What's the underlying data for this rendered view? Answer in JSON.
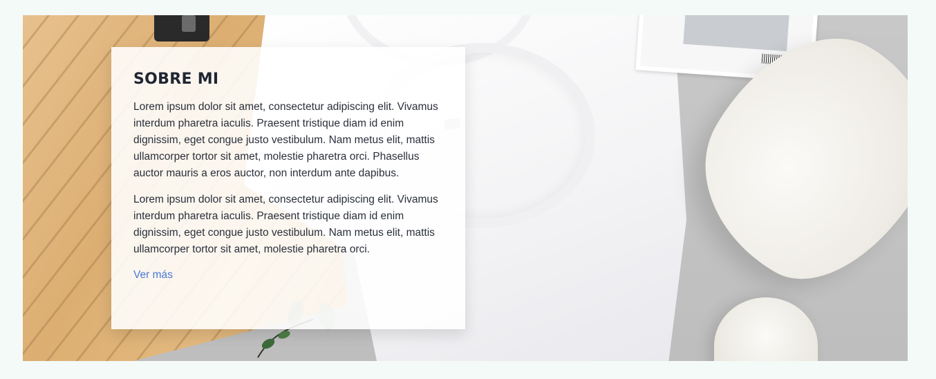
{
  "about": {
    "title": "SOBRE MI",
    "paragraph_1": "Lorem ipsum dolor sit amet, consectetur adipiscing elit. Vivamus interdum pharetra iaculis. Praesent tristique diam id enim dignissim, eget congue justo vestibulum. Nam metus elit, mattis ullamcorper tortor sit amet, molestie pharetra orci. Phasellus auctor mauris a eros auctor, non interdum ante dapibus.",
    "paragraph_2": "Lorem ipsum dolor sit amet, consectetur adipiscing elit. Vivamus interdum pharetra iaculis. Praesent tristique diam id enim dignissim, eget congue justo vestibulum. Nam metus elit, mattis ullamcorper tortor sit amet, molestie pharetra orci.",
    "link_label": "Ver más"
  },
  "colors": {
    "page_background": "#f4faf7",
    "card_background": "#ffffff",
    "title": "#1f2532",
    "link": "#4a78d6"
  }
}
